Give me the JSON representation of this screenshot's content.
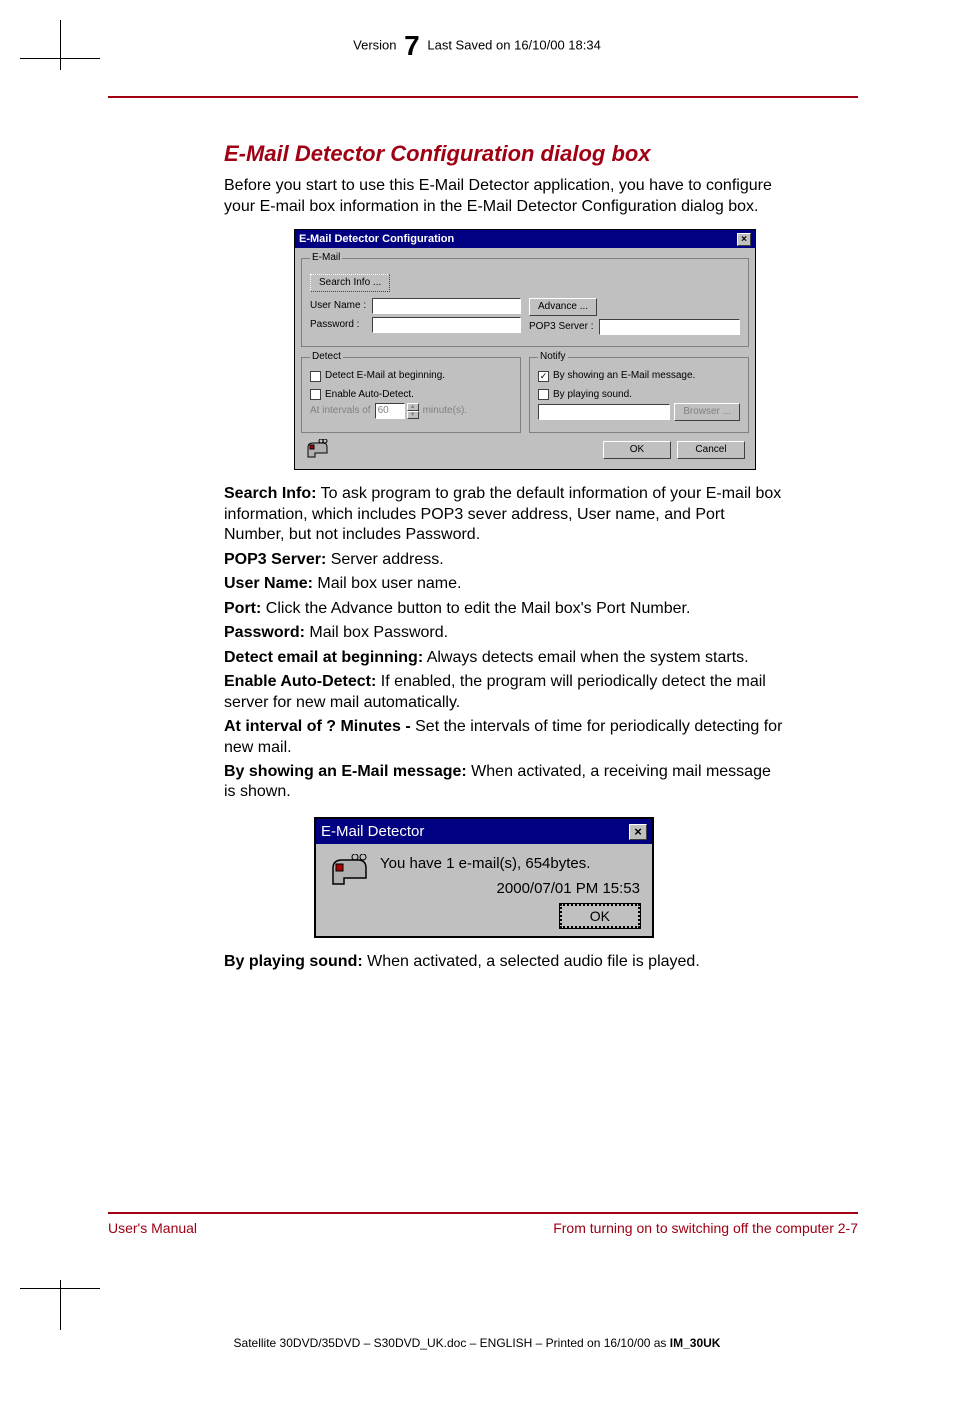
{
  "header": {
    "version_label": "Version",
    "version_num": "7",
    "saved": "Last Saved on 16/10/00 18:34"
  },
  "title": "E-Mail Detector Configuration dialog box",
  "intro": "Before you start to use this E-Mail Detector application, you have to configure your E-mail box information in the E-Mail Detector Configuration dialog box.",
  "dlg1": {
    "title": "E-Mail Detector Configuration",
    "email_legend": "E-Mail",
    "search_info_btn": "Search Info ...",
    "username_lbl": "User Name :",
    "password_lbl": "Password :",
    "advance_btn": "Advance ...",
    "pop3_lbl": "POP3 Server :",
    "detect_legend": "Detect",
    "detect_begin": "Detect E-Mail at beginning.",
    "enable_auto": "Enable Auto-Detect.",
    "interval_prefix": "At intervals of",
    "interval_val": "60",
    "interval_suffix": "minute(s).",
    "notify_legend": "Notify",
    "notify_show": "By showing an E-Mail message.",
    "notify_sound": "By playing sound.",
    "browser_btn": "Browser ...",
    "ok": "OK",
    "cancel": "Cancel"
  },
  "defs": {
    "search_info_b": "Search Info:",
    "search_info_t": " To ask program to grab the default information of your E-mail box information, which includes POP3 sever address, User name, and Port Number, but not includes Password.",
    "pop3_b": "POP3 Server:",
    "pop3_t": " Server address.",
    "user_b": "User Name:",
    "user_t": " Mail box user name.",
    "port_b": "Port:",
    "port_t": " Click the Advance button to edit the Mail box's Port Number.",
    "pass_b": "Password:",
    "pass_t": " Mail box Password.",
    "detb_b": "Detect email at beginning:",
    "detb_t": " Always detects email when the system starts.",
    "auto_b": "Enable Auto-Detect:",
    "auto_t": " If enabled, the program will periodically detect the mail server for new mail automatically.",
    "int_b": "At interval of ? Minutes -",
    "int_t": " Set the intervals of time for periodically detecting for new mail.",
    "show_b": "By showing an E-Mail message:",
    "show_t": " When activated, a receiving mail message is shown.",
    "snd_b": "By playing sound:",
    "snd_t": " When activated, a selected audio file is played."
  },
  "dlg2": {
    "title": "E-Mail Detector",
    "msg": "You have 1 e-mail(s), 654bytes.",
    "ts": "2000/07/01  PM 15:53",
    "ok": "OK"
  },
  "footer": {
    "left": "User's Manual",
    "right": "From turning on to switching off the computer  2-7"
  },
  "bottom": {
    "prefix": "Satellite 30DVD/35DVD  – S30DVD_UK.doc – ENGLISH – Printed on 16/10/00 as ",
    "bold": "IM_30UK"
  }
}
